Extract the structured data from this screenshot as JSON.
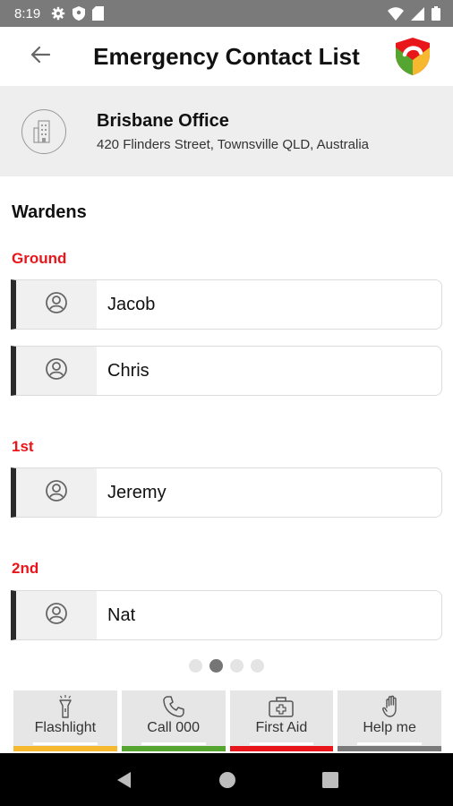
{
  "status_bar": {
    "time": "8:19",
    "left_icons": [
      "gear-icon",
      "shield-icon",
      "sd-card-icon"
    ],
    "right_icons": [
      "wifi-icon",
      "signal-icon",
      "battery-icon"
    ]
  },
  "app_bar": {
    "back_icon": "back-arrow-icon",
    "title": "Emergency Contact List",
    "logo_icon": "app-logo-shield-icon"
  },
  "office": {
    "icon": "building-icon",
    "name": "Brisbane Office",
    "address": "420 Flinders Street, Townsville QLD, Australia"
  },
  "section_title": "Wardens",
  "floors": [
    {
      "label": "Ground",
      "wardens": [
        {
          "name": "Jacob"
        },
        {
          "name": "Chris"
        }
      ]
    },
    {
      "label": "1st",
      "wardens": [
        {
          "name": "Jeremy"
        }
      ]
    },
    {
      "label": "2nd",
      "wardens": [
        {
          "name": "Nat"
        }
      ]
    }
  ],
  "pager": {
    "count": 4,
    "active_index": 1
  },
  "actions": [
    {
      "label": "Flashlight",
      "icon": "flashlight-icon",
      "color": "#f5b82e"
    },
    {
      "label": "Call 000",
      "icon": "phone-icon",
      "color": "#55a630"
    },
    {
      "label": "First Aid",
      "icon": "first-aid-kit-icon",
      "color": "#e8161b"
    },
    {
      "label": "Help me",
      "icon": "hand-icon",
      "color": "#7a7a7a"
    }
  ],
  "colors": {
    "accent_red": "#e8161b",
    "status_bar": "#7a7a7a",
    "card_border_left": "#2a2a2a"
  }
}
